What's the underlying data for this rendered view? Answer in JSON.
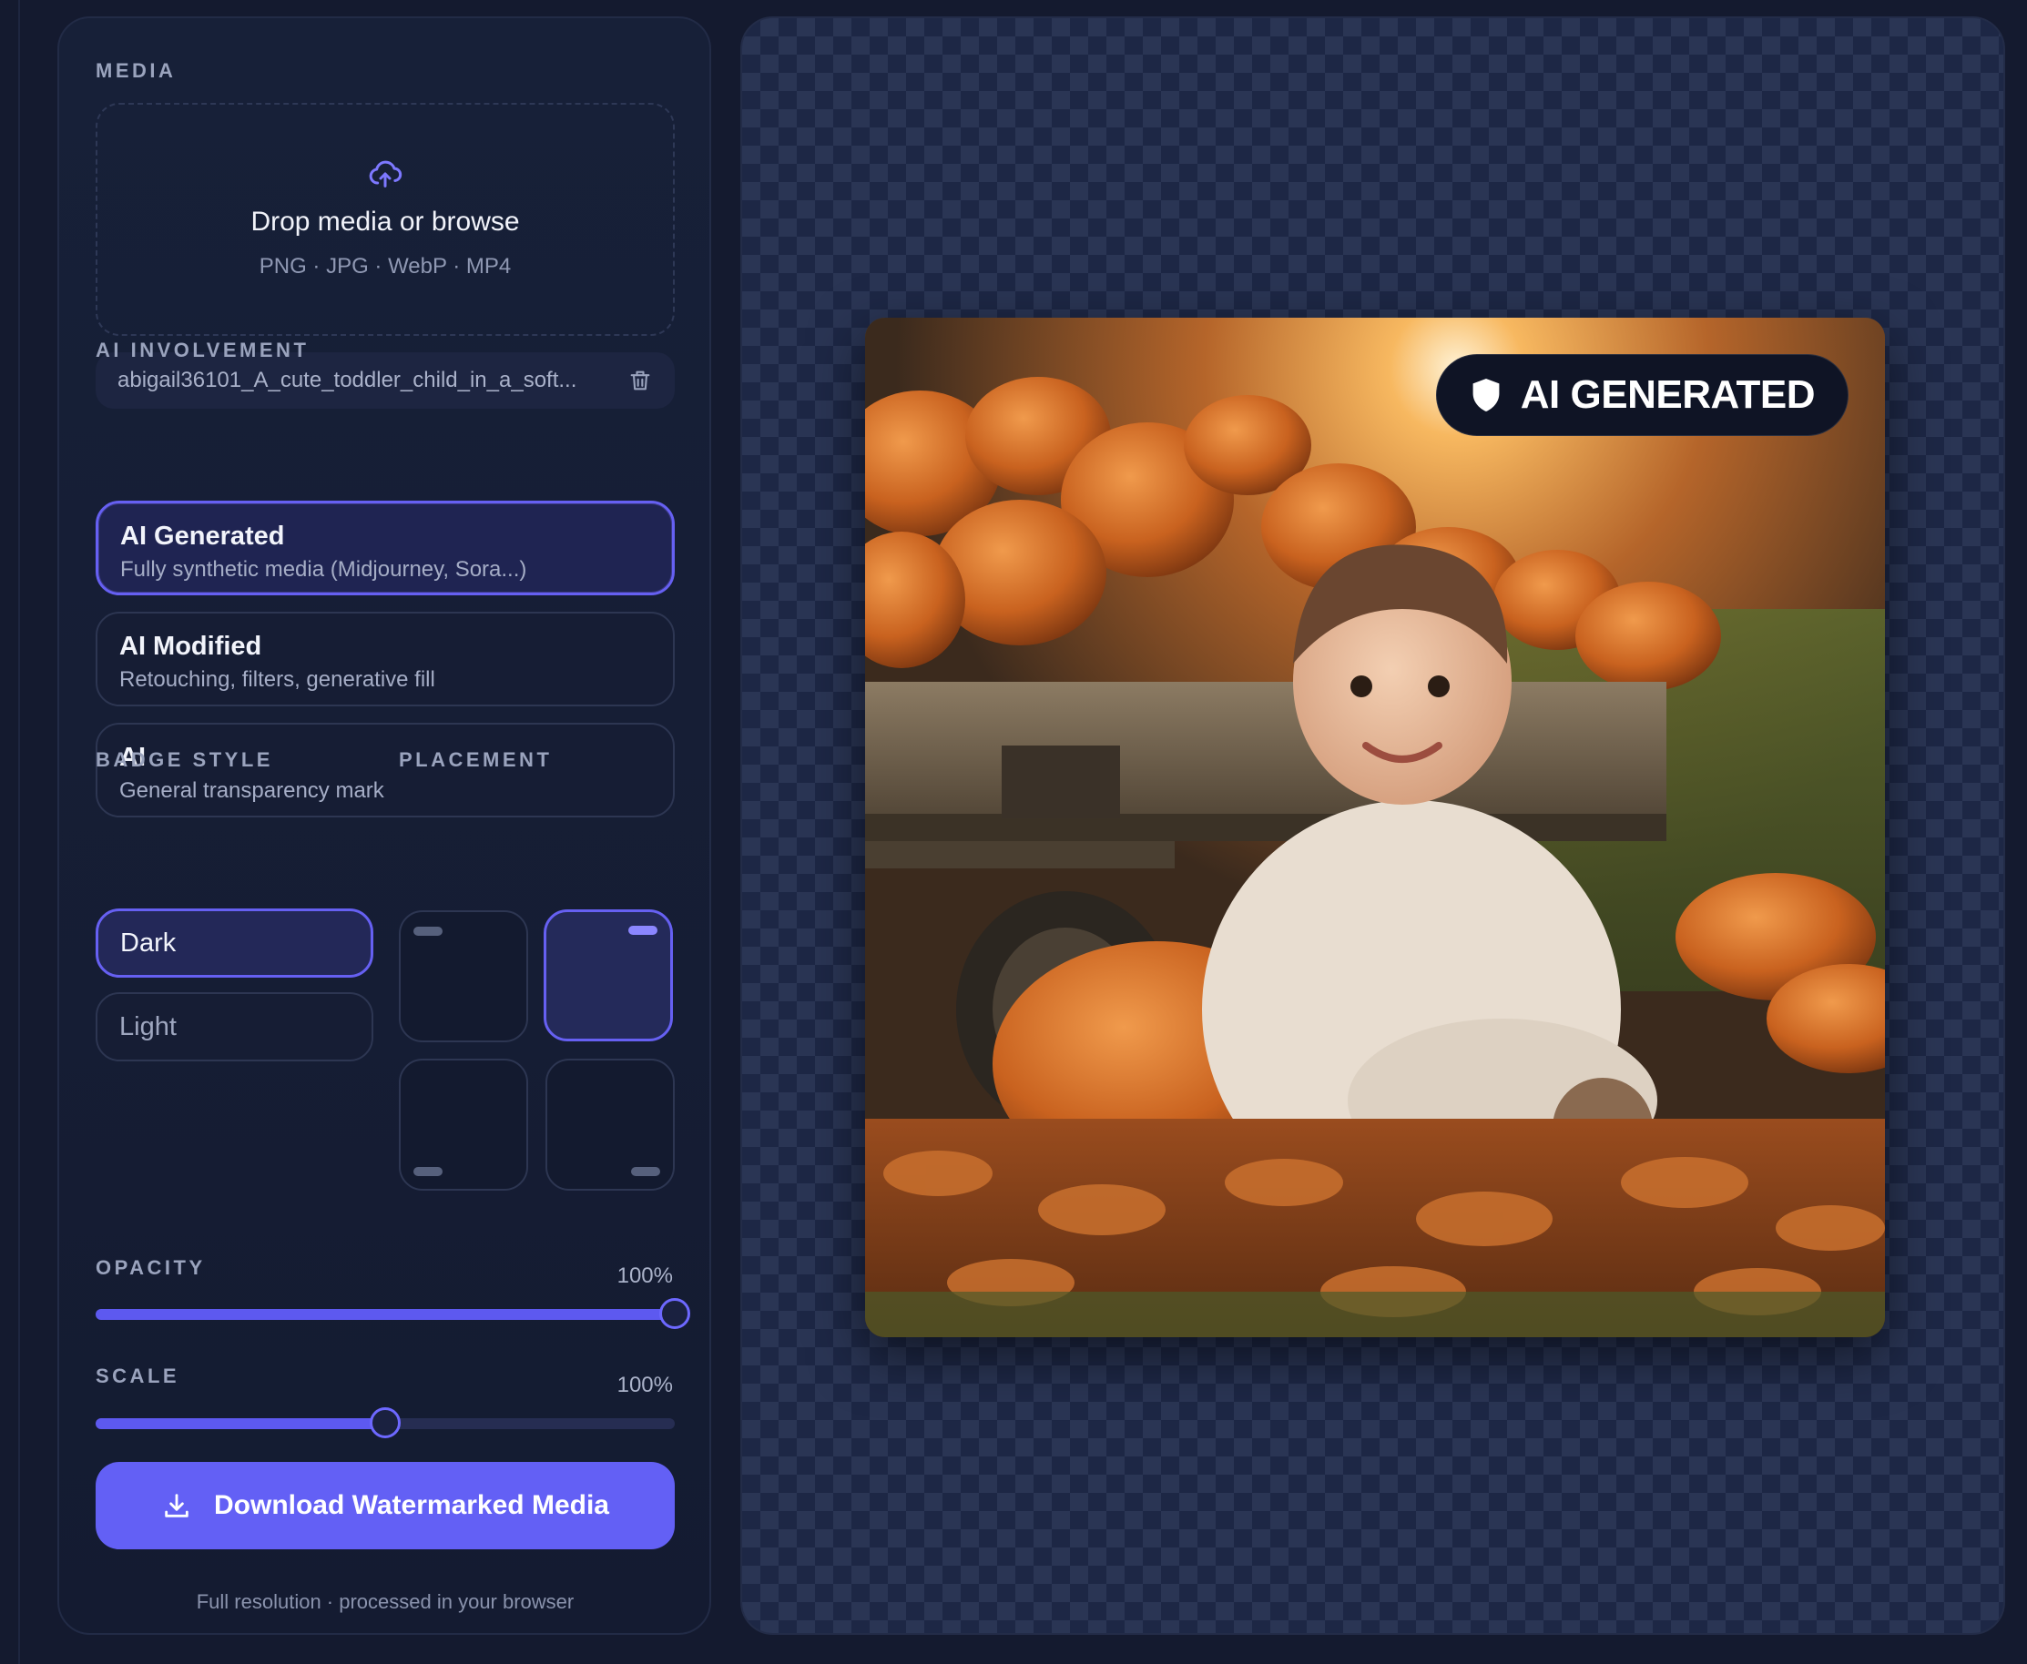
{
  "media": {
    "section_label": "MEDIA",
    "dropzone_title": "Drop media or browse",
    "dropzone_formats": "PNG · JPG · WebP · MP4",
    "file_name": "abigail36101_A_cute_toddler_child_in_a_soft..."
  },
  "ai_involvement": {
    "section_label": "AI INVOLVEMENT",
    "options": [
      {
        "title": "AI Generated",
        "subtitle": "Fully synthetic media (Midjourney, Sora...)",
        "selected": true
      },
      {
        "title": "AI Modified",
        "subtitle": "Retouching, filters, generative fill",
        "selected": false
      },
      {
        "title": "AI",
        "subtitle": "General transparency mark",
        "selected": false
      }
    ]
  },
  "badge_style": {
    "section_label": "BADGE STYLE",
    "options": [
      {
        "label": "Dark",
        "selected": true
      },
      {
        "label": "Light",
        "selected": false
      }
    ]
  },
  "placement": {
    "section_label": "PLACEMENT",
    "selected": "top-right",
    "cells": [
      "top-left",
      "top-right",
      "bottom-left",
      "bottom-right"
    ]
  },
  "opacity": {
    "label": "OPACITY",
    "value_text": "100%",
    "value": 1.0
  },
  "scale": {
    "label": "SCALE",
    "value_text": "100%",
    "value": 0.5
  },
  "download": {
    "label": "Download Watermarked Media",
    "footnote": "Full resolution · processed in your browser"
  },
  "preview": {
    "badge_text": "AI GENERATED"
  },
  "colors": {
    "accent": "#6360f5",
    "panel_bg": "#172038",
    "page_bg": "#141a2f"
  },
  "icons": [
    "cloud-upload-icon",
    "trash-icon",
    "download-icon",
    "shield-icon"
  ]
}
